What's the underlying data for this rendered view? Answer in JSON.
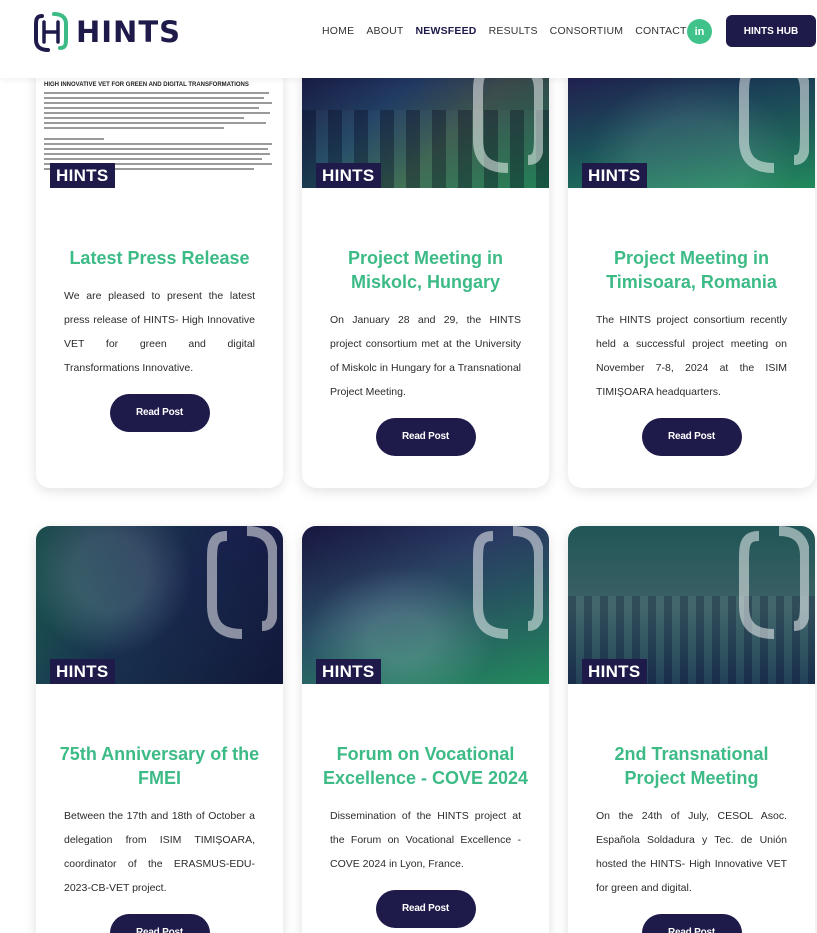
{
  "brand": {
    "name": "HINTS"
  },
  "nav": [
    "HOME",
    "ABOUT",
    "NEWSFEED",
    "RESULTS",
    "CONSORTIUM",
    "CONTACT"
  ],
  "nav_active": "NEWSFEED",
  "linkedin_label": "in",
  "hub_button": "HINTS HUB",
  "press_doc_heading": "HIGH INNOVATIVE VET FOR GREEN AND DIGITAL TRANSFORMATIONS",
  "colors": {
    "navy": "#1e1b4b",
    "green": "#3dbb86"
  },
  "cards": [
    {
      "badge": "HINTS",
      "title": "Latest Press Release",
      "desc": "We are pleased to present the latest press release of HINTS- High Innovative VET for green and digital Transformations Innovative.",
      "button": "Read Post"
    },
    {
      "badge": "HINTS",
      "title": "Project Meeting in Miskolc, Hungary",
      "desc": "On January 28 and 29, the HINTS project consortium met at the University of Miskolc in Hungary for a Transnational Project Meeting.",
      "button": "Read Post"
    },
    {
      "badge": "HINTS",
      "title": "Project Meeting in Timisoara, Romania",
      "desc": "The HINTS project consortium recently held a successful project meeting on November 7-8, 2024 at the ISIM TIMIŞOARA headquarters.",
      "button": "Read Post"
    },
    {
      "badge": "HINTS",
      "title": "75th Anniversary of the FMEI",
      "desc": "Between the 17th and 18th of October a delegation from ISIM TIMIŞOARA, coordinator of the ERASMUS-EDU-2023-CB-VET project.",
      "button": "Read Post"
    },
    {
      "badge": "HINTS",
      "title": "Forum on Vocational Excellence - COVE 2024",
      "desc": "Dissemination of the HINTS project at the Forum on Vocational Excellence - COVE 2024 in Lyon, France.",
      "button": "Read Post"
    },
    {
      "badge": "HINTS",
      "title": "2nd Transnational Project Meeting",
      "desc": "On the 24th of July, CESOL Asoc. Española Soldadura y Tec. de Unión hosted the HINTS- High Innovative VET for green and digital.",
      "button": "Read Post"
    }
  ]
}
